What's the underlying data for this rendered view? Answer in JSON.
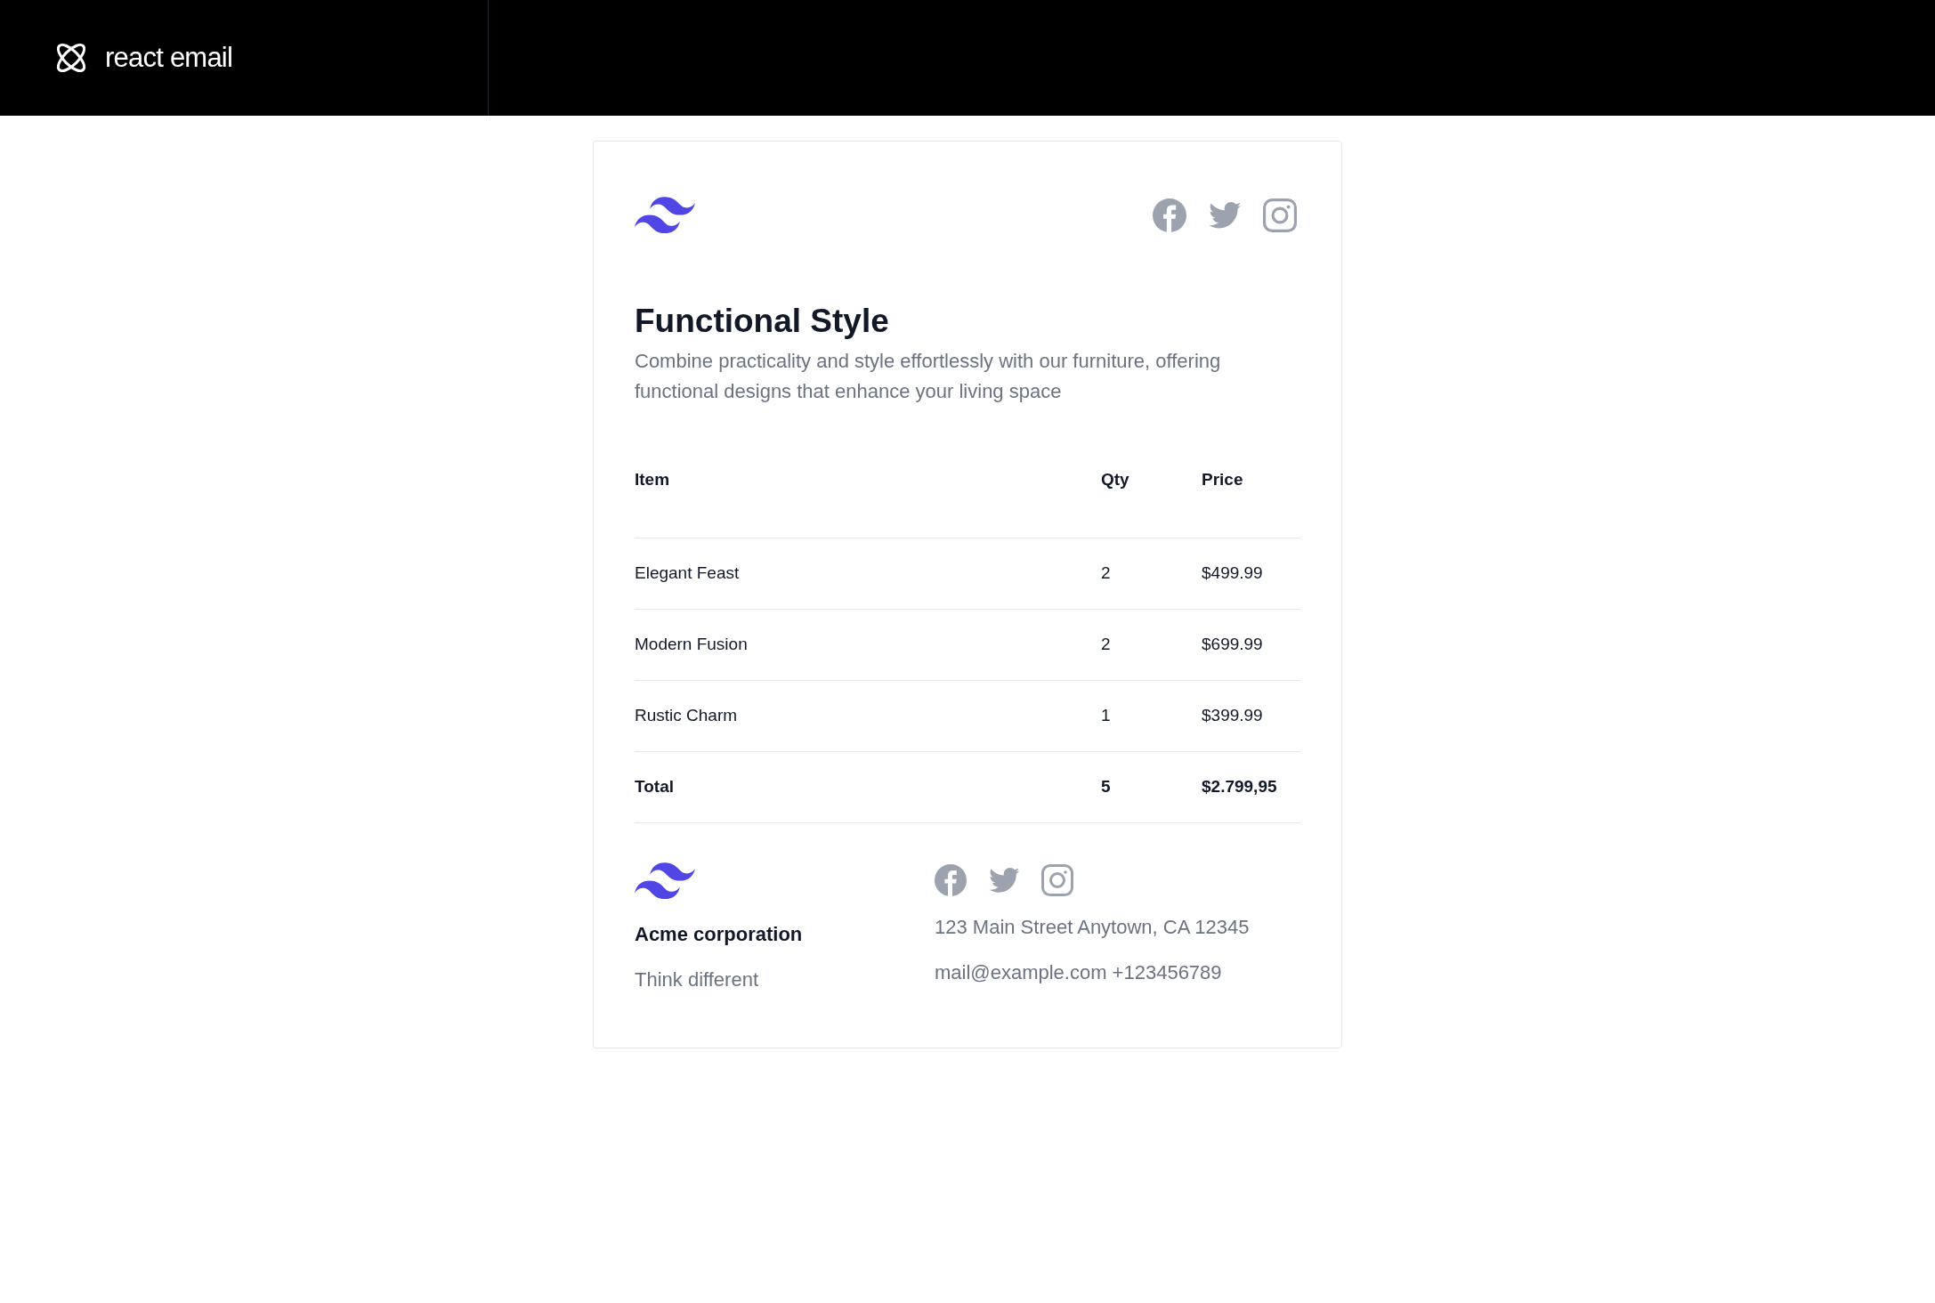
{
  "header": {
    "brand": "react email"
  },
  "email": {
    "title": "Functional Style",
    "description": "Combine practicality and style effortlessly with our furniture, offering functional designs that enhance your living space",
    "table": {
      "columns": [
        "Item",
        "Qty",
        "Price"
      ],
      "rows": [
        {
          "kind": "item",
          "cells": [
            "Elegant Feast",
            "2",
            "$499.99"
          ]
        },
        {
          "kind": "item",
          "cells": [
            "Modern Fusion",
            "2",
            "$699.99"
          ]
        },
        {
          "kind": "item",
          "cells": [
            "Rustic Charm",
            "1",
            "$399.99"
          ]
        },
        {
          "kind": "total",
          "cells": [
            "Total",
            "5",
            "$2.799,95"
          ]
        }
      ]
    },
    "footer": {
      "company": "Acme corporation",
      "tagline": "Think different",
      "address": "123 Main Street Anytown, CA 12345",
      "contact": "mail@example.com +123456789"
    }
  }
}
